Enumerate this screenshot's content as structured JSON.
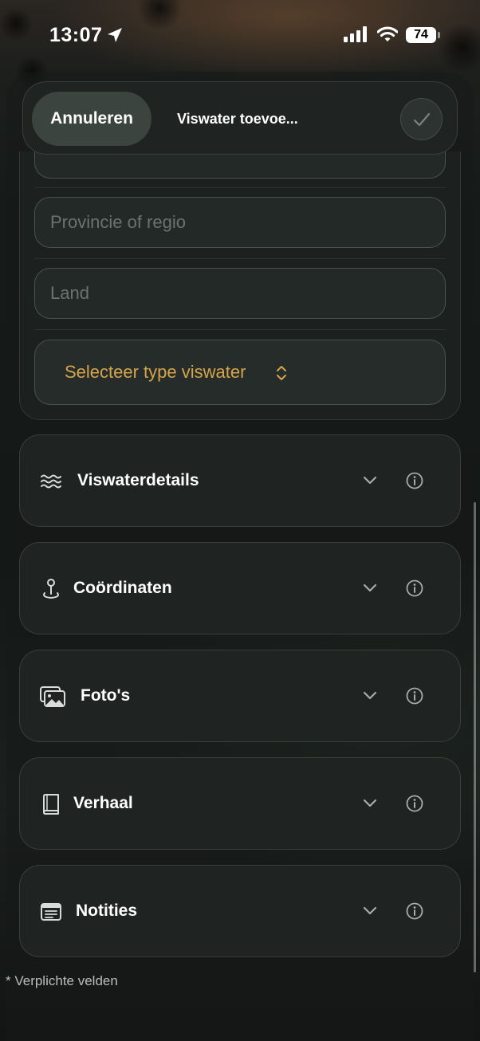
{
  "status_bar": {
    "time": "13:07",
    "battery": "74"
  },
  "navbar": {
    "cancel_label": "Annuleren",
    "title": "Viswater toevoe..."
  },
  "form": {
    "region_placeholder": "Provincie of regio",
    "country_placeholder": "Land",
    "type_select_label": "Selecteer type viswater"
  },
  "sections": [
    {
      "title": "Viswaterdetails",
      "icon": "waves-icon"
    },
    {
      "title": "Coördinaten",
      "icon": "map-pin-icon"
    },
    {
      "title": "Foto's",
      "icon": "photos-icon"
    },
    {
      "title": "Verhaal",
      "icon": "book-icon"
    },
    {
      "title": "Notities",
      "icon": "notes-icon"
    }
  ],
  "footnote": "* Verplichte velden",
  "colors": {
    "accent": "#d4a54c",
    "card": "#1f2321",
    "field_border": "#4a524d"
  }
}
